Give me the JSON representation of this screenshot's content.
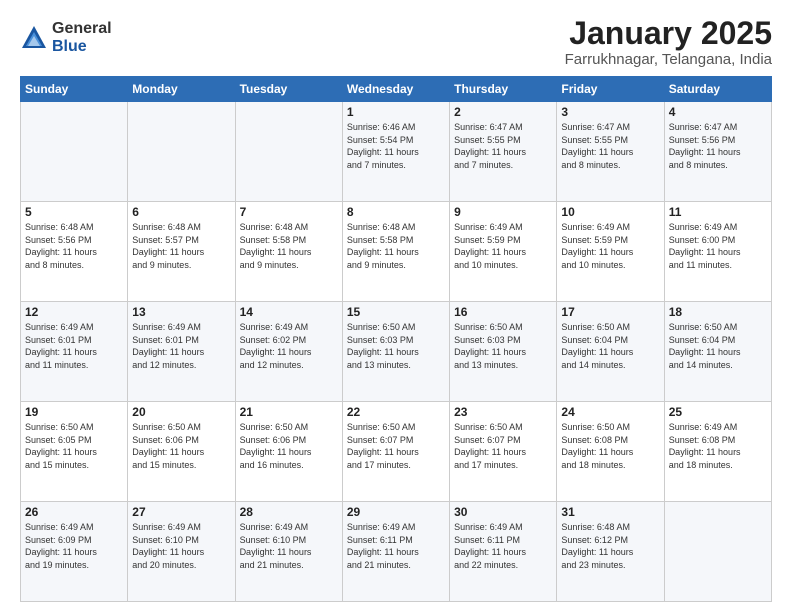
{
  "logo": {
    "general": "General",
    "blue": "Blue"
  },
  "title": "January 2025",
  "location": "Farrukhnagar, Telangana, India",
  "days_of_week": [
    "Sunday",
    "Monday",
    "Tuesday",
    "Wednesday",
    "Thursday",
    "Friday",
    "Saturday"
  ],
  "weeks": [
    [
      {
        "day": "",
        "info": ""
      },
      {
        "day": "",
        "info": ""
      },
      {
        "day": "",
        "info": ""
      },
      {
        "day": "1",
        "info": "Sunrise: 6:46 AM\nSunset: 5:54 PM\nDaylight: 11 hours\nand 7 minutes."
      },
      {
        "day": "2",
        "info": "Sunrise: 6:47 AM\nSunset: 5:55 PM\nDaylight: 11 hours\nand 7 minutes."
      },
      {
        "day": "3",
        "info": "Sunrise: 6:47 AM\nSunset: 5:55 PM\nDaylight: 11 hours\nand 8 minutes."
      },
      {
        "day": "4",
        "info": "Sunrise: 6:47 AM\nSunset: 5:56 PM\nDaylight: 11 hours\nand 8 minutes."
      }
    ],
    [
      {
        "day": "5",
        "info": "Sunrise: 6:48 AM\nSunset: 5:56 PM\nDaylight: 11 hours\nand 8 minutes."
      },
      {
        "day": "6",
        "info": "Sunrise: 6:48 AM\nSunset: 5:57 PM\nDaylight: 11 hours\nand 9 minutes."
      },
      {
        "day": "7",
        "info": "Sunrise: 6:48 AM\nSunset: 5:58 PM\nDaylight: 11 hours\nand 9 minutes."
      },
      {
        "day": "8",
        "info": "Sunrise: 6:48 AM\nSunset: 5:58 PM\nDaylight: 11 hours\nand 9 minutes."
      },
      {
        "day": "9",
        "info": "Sunrise: 6:49 AM\nSunset: 5:59 PM\nDaylight: 11 hours\nand 10 minutes."
      },
      {
        "day": "10",
        "info": "Sunrise: 6:49 AM\nSunset: 5:59 PM\nDaylight: 11 hours\nand 10 minutes."
      },
      {
        "day": "11",
        "info": "Sunrise: 6:49 AM\nSunset: 6:00 PM\nDaylight: 11 hours\nand 11 minutes."
      }
    ],
    [
      {
        "day": "12",
        "info": "Sunrise: 6:49 AM\nSunset: 6:01 PM\nDaylight: 11 hours\nand 11 minutes."
      },
      {
        "day": "13",
        "info": "Sunrise: 6:49 AM\nSunset: 6:01 PM\nDaylight: 11 hours\nand 12 minutes."
      },
      {
        "day": "14",
        "info": "Sunrise: 6:49 AM\nSunset: 6:02 PM\nDaylight: 11 hours\nand 12 minutes."
      },
      {
        "day": "15",
        "info": "Sunrise: 6:50 AM\nSunset: 6:03 PM\nDaylight: 11 hours\nand 13 minutes."
      },
      {
        "day": "16",
        "info": "Sunrise: 6:50 AM\nSunset: 6:03 PM\nDaylight: 11 hours\nand 13 minutes."
      },
      {
        "day": "17",
        "info": "Sunrise: 6:50 AM\nSunset: 6:04 PM\nDaylight: 11 hours\nand 14 minutes."
      },
      {
        "day": "18",
        "info": "Sunrise: 6:50 AM\nSunset: 6:04 PM\nDaylight: 11 hours\nand 14 minutes."
      }
    ],
    [
      {
        "day": "19",
        "info": "Sunrise: 6:50 AM\nSunset: 6:05 PM\nDaylight: 11 hours\nand 15 minutes."
      },
      {
        "day": "20",
        "info": "Sunrise: 6:50 AM\nSunset: 6:06 PM\nDaylight: 11 hours\nand 15 minutes."
      },
      {
        "day": "21",
        "info": "Sunrise: 6:50 AM\nSunset: 6:06 PM\nDaylight: 11 hours\nand 16 minutes."
      },
      {
        "day": "22",
        "info": "Sunrise: 6:50 AM\nSunset: 6:07 PM\nDaylight: 11 hours\nand 17 minutes."
      },
      {
        "day": "23",
        "info": "Sunrise: 6:50 AM\nSunset: 6:07 PM\nDaylight: 11 hours\nand 17 minutes."
      },
      {
        "day": "24",
        "info": "Sunrise: 6:50 AM\nSunset: 6:08 PM\nDaylight: 11 hours\nand 18 minutes."
      },
      {
        "day": "25",
        "info": "Sunrise: 6:49 AM\nSunset: 6:08 PM\nDaylight: 11 hours\nand 18 minutes."
      }
    ],
    [
      {
        "day": "26",
        "info": "Sunrise: 6:49 AM\nSunset: 6:09 PM\nDaylight: 11 hours\nand 19 minutes."
      },
      {
        "day": "27",
        "info": "Sunrise: 6:49 AM\nSunset: 6:10 PM\nDaylight: 11 hours\nand 20 minutes."
      },
      {
        "day": "28",
        "info": "Sunrise: 6:49 AM\nSunset: 6:10 PM\nDaylight: 11 hours\nand 21 minutes."
      },
      {
        "day": "29",
        "info": "Sunrise: 6:49 AM\nSunset: 6:11 PM\nDaylight: 11 hours\nand 21 minutes."
      },
      {
        "day": "30",
        "info": "Sunrise: 6:49 AM\nSunset: 6:11 PM\nDaylight: 11 hours\nand 22 minutes."
      },
      {
        "day": "31",
        "info": "Sunrise: 6:48 AM\nSunset: 6:12 PM\nDaylight: 11 hours\nand 23 minutes."
      },
      {
        "day": "",
        "info": ""
      }
    ]
  ]
}
